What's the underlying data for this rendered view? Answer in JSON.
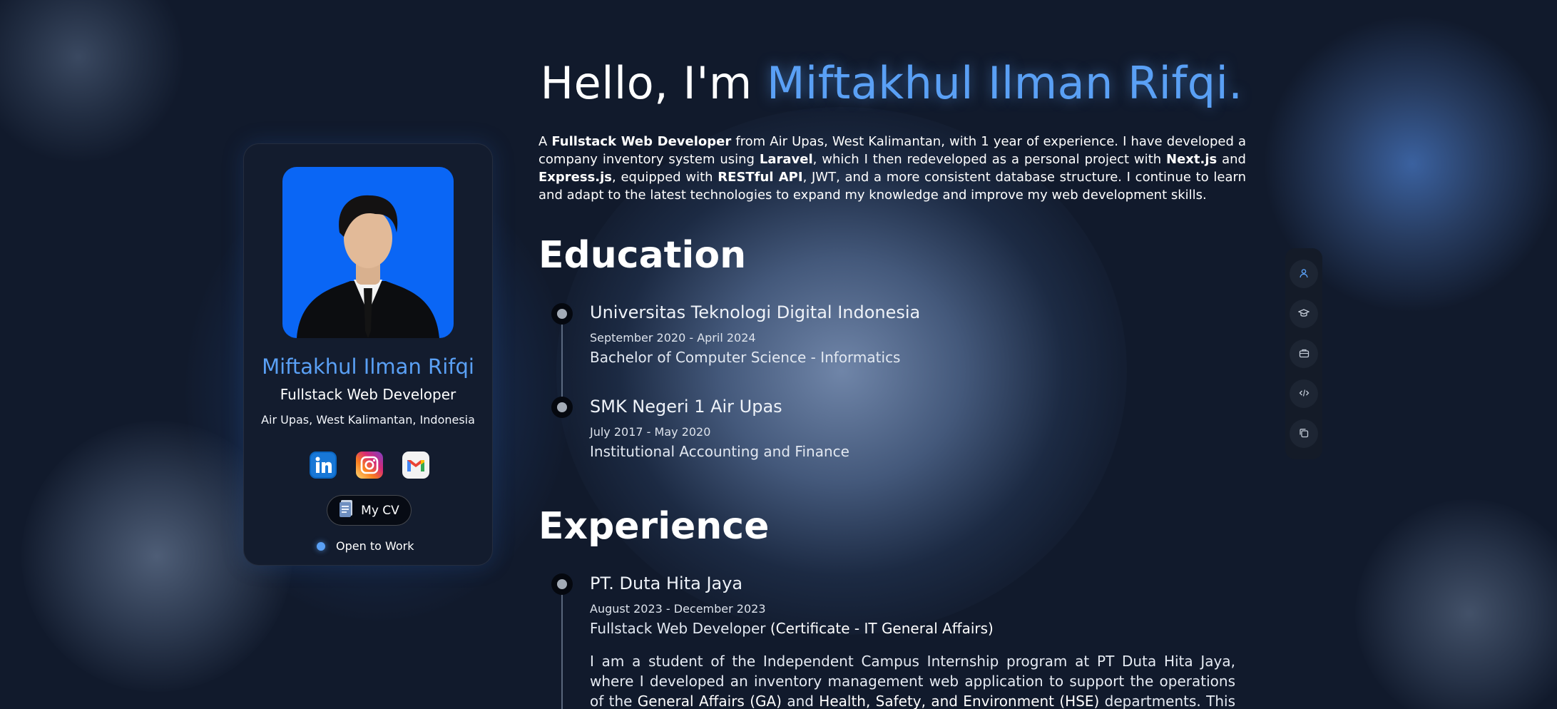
{
  "hero": {
    "hello_prefix": "Hello, I'm",
    "hello_name": "Miftakhul Ilman Rifqi."
  },
  "intro": {
    "t1": "A ",
    "b1": "Fullstack Web Developer",
    "t2": " from Air Upas, West Kalimantan, with 1 year of experience. I have developed a company inventory system using ",
    "b2": "Laravel",
    "t3": ", which I then redeveloped as a personal project with ",
    "b3": "Next.js",
    "t4": " and ",
    "b4": "Express.js",
    "t5": ", equipped with ",
    "b5": "RESTful API",
    "t6": ", JWT, and a more consistent database structure. I continue to learn and adapt to the latest technologies to expand my knowledge and improve my web development skills."
  },
  "profile": {
    "name": "Miftakhul Ilman Rifqi",
    "role": "Fullstack Web Developer",
    "location": "Air Upas, West Kalimantan, Indonesia",
    "socials": [
      {
        "icon": "linkedin-icon"
      },
      {
        "icon": "instagram-icon"
      },
      {
        "icon": "gmail-icon"
      }
    ],
    "cv_label": "My CV",
    "status": "Open to Work"
  },
  "education": {
    "title": "Education",
    "items": [
      {
        "school": "Universitas Teknologi Digital Indonesia",
        "date": "September 2020 - April 2024",
        "degree": "Bachelor of Computer Science - Informatics"
      },
      {
        "school": "SMK Negeri 1 Air Upas",
        "date": "July 2017 - May 2020",
        "degree": "Institutional Accounting and Finance"
      }
    ]
  },
  "experience": {
    "title": "Experience",
    "items": [
      {
        "company": "PT. Duta Hita Jaya",
        "date": "August 2023 - December 2023",
        "role": "Fullstack Web Developer",
        "role_note": "(Certificate - IT General Affairs)",
        "desc_1": "I am a student of the Independent Campus Internship program at PT Duta Hita Jaya, where I developed an inventory management web application to support the operations of the ",
        "desc_b1": "General Affairs (GA)",
        "desc_2": " and ",
        "desc_b2": "Health, Safety, and Environment (HSE)",
        "desc_3": " departments. This application"
      }
    ]
  },
  "side_nav": {
    "items": [
      "user-icon",
      "graduation-cap-icon",
      "briefcase-icon",
      "code-icon",
      "copy-icon"
    ]
  },
  "colors": {
    "accent": "#5aa0f5",
    "background": "#111a2c",
    "photo_bg": "#0a66f5"
  }
}
